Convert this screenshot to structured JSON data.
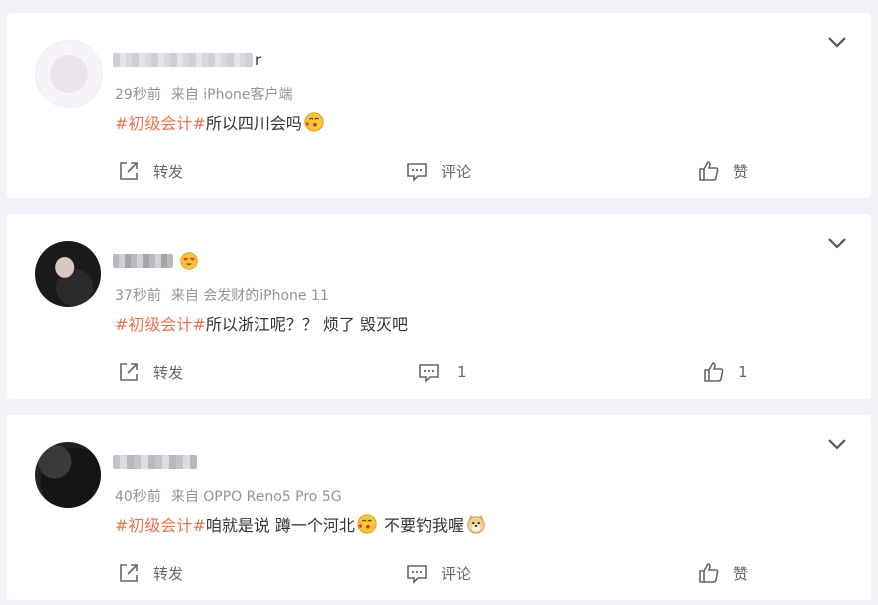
{
  "posts": [
    {
      "name_suffix": "r",
      "time": "29秒前",
      "source": "来自 iPhone客户端",
      "hashtag": "#初级会计#",
      "text": "所以四川会吗",
      "share_label": "转发",
      "comment_label": "评论",
      "like_label": "赞"
    },
    {
      "name_suffix": "",
      "time": "37秒前",
      "source": "来自 会发财的iPhone 11",
      "hashtag": "#初级会计#",
      "text": "所以浙江呢？？ 烦了 毁灭吧",
      "share_label": "转发",
      "comment_count": "1",
      "like_count": "1"
    },
    {
      "name_suffix": "",
      "time": "40秒前",
      "source": "来自 OPPO Reno5 Pro 5G",
      "hashtag": "#初级会计#",
      "text": "咱就是说 蹲一个河北",
      "text2": " 不要钓我喔",
      "share_label": "转发",
      "comment_label": "评论",
      "like_label": "赞"
    }
  ],
  "colors": {
    "hashtag": "#eb7350",
    "meta": "#939393",
    "background": "#f1f2f5"
  }
}
